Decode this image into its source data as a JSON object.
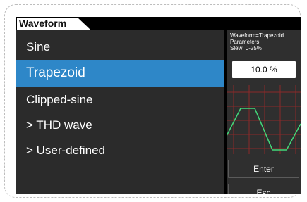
{
  "window": {
    "title": "Waveform"
  },
  "list": {
    "items": [
      {
        "label": "Sine",
        "selected": false
      },
      {
        "label": "Trapezoid",
        "selected": true
      },
      {
        "label": "Clipped-sine",
        "selected": false
      },
      {
        "label": "> THD wave",
        "selected": false
      },
      {
        "label": "> User-defined",
        "selected": false
      }
    ]
  },
  "info": {
    "line1": "Waveform=Trapezoid",
    "line2": "Parameters:",
    "line3": "Slew: 0-25%"
  },
  "parameter": {
    "value": "10.0 %"
  },
  "buttons": {
    "enter": "Enter",
    "esc": "Esc"
  },
  "colors": {
    "selected": "#2e87c8",
    "list_bg": "#2b2b2b",
    "panel_bg": "#2f2f2f",
    "waveform": "#42d97a",
    "grid": "#8b2a2a"
  },
  "icons": {
    "waveform_preview": "trapezoid-wave-icon"
  }
}
